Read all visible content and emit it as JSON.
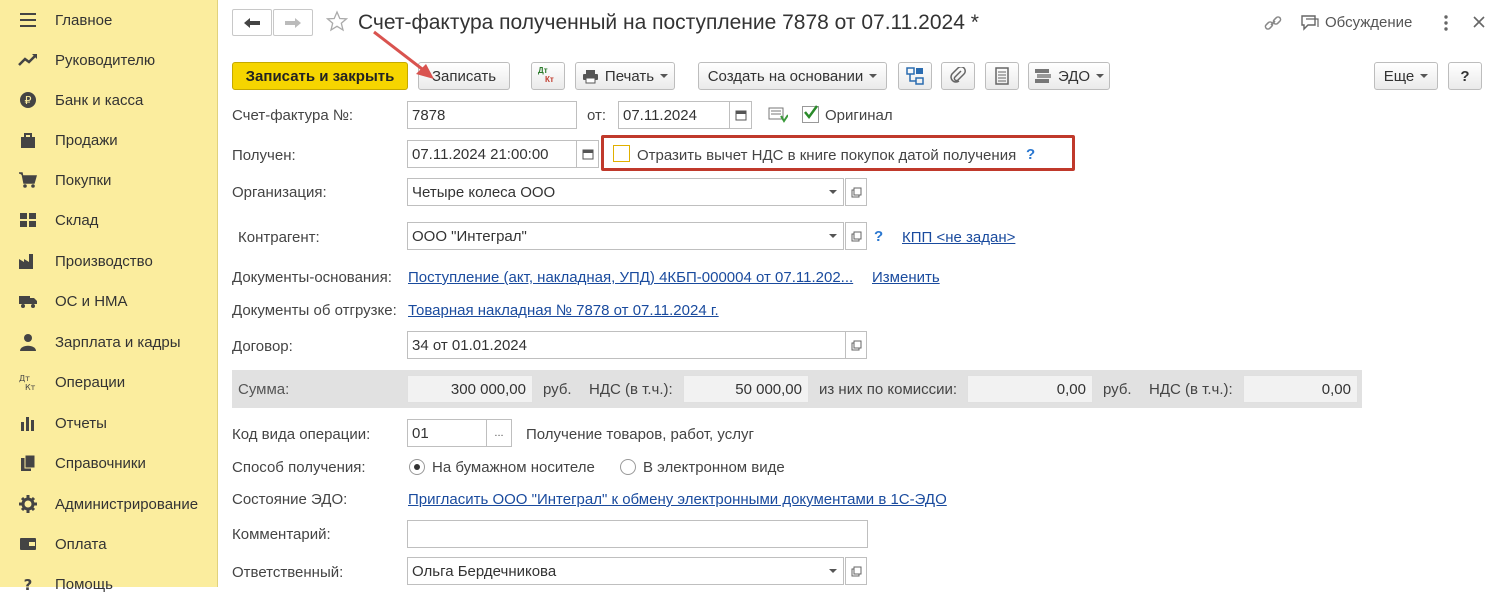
{
  "sidebar": {
    "items": [
      {
        "label": "Главное",
        "icon": "menu-icon"
      },
      {
        "label": "Руководителю",
        "icon": "trend-icon"
      },
      {
        "label": "Банк и касса",
        "icon": "coin-icon"
      },
      {
        "label": "Продажи",
        "icon": "bag-icon"
      },
      {
        "label": "Покупки",
        "icon": "cart-icon"
      },
      {
        "label": "Склад",
        "icon": "warehouse-icon"
      },
      {
        "label": "Производство",
        "icon": "factory-icon"
      },
      {
        "label": "ОС и НМА",
        "icon": "truck-icon"
      },
      {
        "label": "Зарплата и кадры",
        "icon": "person-icon"
      },
      {
        "label": "Операции",
        "icon": "dt-kt-icon"
      },
      {
        "label": "Отчеты",
        "icon": "bar-chart-icon"
      },
      {
        "label": "Справочники",
        "icon": "books-icon"
      },
      {
        "label": "Администрирование",
        "icon": "gear-icon"
      },
      {
        "label": "Оплата",
        "icon": "wallet-icon"
      },
      {
        "label": "Помощь",
        "icon": "help-icon"
      }
    ]
  },
  "header": {
    "title": "Счет-фактура полученный на поступление 7878 от 07.11.2024 *",
    "discussion": "Обсуждение"
  },
  "toolbar": {
    "save_close": "Записать и закрыть",
    "save": "Записать",
    "dtkt_top": "Дт",
    "dtkt_bottom": "Кт",
    "print": "Печать",
    "create_based": "Создать на основании",
    "edo": "ЭДО",
    "more": "Еще",
    "help": "?"
  },
  "form": {
    "invoice_label": "Счет-фактура №:",
    "invoice_number": "7878",
    "from_label": "от:",
    "invoice_date": "07.11.2024",
    "original_label": "Оригинал",
    "received_label": "Получен:",
    "received_date": "07.11.2024 21:00:00",
    "vat_checkbox_label": "Отразить вычет НДС в книге покупок датой получения",
    "org_label": "Организация:",
    "org_value": "Четыре колеса ООО",
    "contractor_label": "Контрагент:",
    "contractor_value": "ООО \"Интеграл\"",
    "kpp_link": "КПП <не задан>",
    "base_docs_label": "Документы-основания:",
    "base_docs_link": "Поступление (акт, накладная, УПД) 4КБП-000004 от 07.11.202...",
    "change_link": "Изменить",
    "shipment_docs_label": "Документы об отгрузке:",
    "shipment_docs_link": "Товарная накладная № 7878 от 07.11.2024 г.",
    "contract_label": "Договор:",
    "contract_value": "34 от 01.01.2024",
    "sum_label": "Сумма:",
    "sum_value": "300 000,00",
    "currency1": "руб.",
    "vat_label1": "НДС (в т.ч.):",
    "vat_value1": "50 000,00",
    "commission_label": "из них по комиссии:",
    "commission_value": "0,00",
    "currency2": "руб.",
    "vat_label2": "НДС (в т.ч.):",
    "vat_value2": "0,00",
    "op_code_label": "Код вида операции:",
    "op_code_value": "01",
    "op_code_desc": "Получение товаров, работ, услуг",
    "method_label": "Способ получения:",
    "method_paper": "На бумажном носителе",
    "method_electronic": "В электронном виде",
    "edo_state_label": "Состояние ЭДО:",
    "edo_state_link": "Пригласить ООО \"Интеграл\" к обмену электронными документами в 1С-ЭДО",
    "comment_label": "Комментарий:",
    "comment_value": "",
    "responsible_label": "Ответственный:",
    "responsible_value": "Ольга Бердечникова"
  },
  "colors": {
    "sidebar_bg": "#fbed9e",
    "primary_button": "#f6d500",
    "highlight_frame": "#c0392b",
    "arrow": "#d9534f",
    "link": "#1a4b9e"
  }
}
